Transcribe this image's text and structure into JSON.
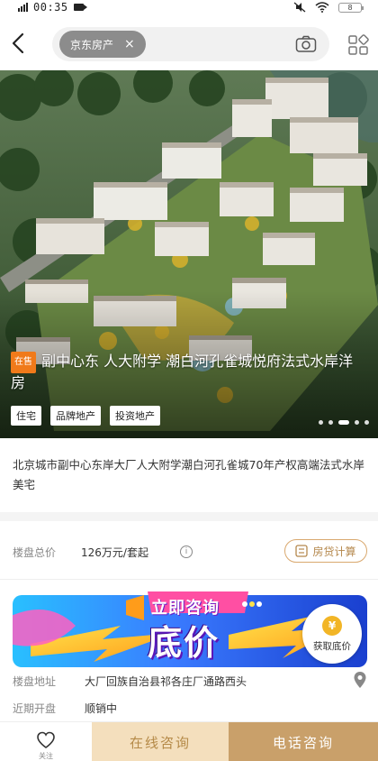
{
  "status_bar": {
    "time": "00:35",
    "battery": "8"
  },
  "header": {
    "search_chip": "京东房产",
    "chip_close": "×"
  },
  "hero": {
    "sale_badge": "在售",
    "title": "副中心东 人大附学 潮白河孔雀城悦府法式水岸洋房",
    "tags": [
      "住宅",
      "品牌地产",
      "投资地产"
    ],
    "slide_count": 6,
    "active_slide": 3
  },
  "description": "北京城市副中心东岸大厂人大附学潮白河孔雀城70年产权高端法式水岸美宅",
  "price": {
    "label": "楼盘总价",
    "value": "126万元/套起",
    "info_icon": "i",
    "mortgage_button": "房贷计算"
  },
  "banner": {
    "top_text": "立即咨询",
    "big_text": "底价",
    "button_label": "获取底价",
    "coin": "¥"
  },
  "address": {
    "label": "楼盘地址",
    "value": "大厂回族自治县祁各庄厂通路西头"
  },
  "opening": {
    "label": "近期开盘",
    "value": "顺销中"
  },
  "bottom_bar": {
    "favorite_label": "关注",
    "online_consult": "在线咨询",
    "phone_consult": "电话咨询"
  },
  "colors": {
    "accent_gold": "#c9a06a",
    "accent_light": "#f4dfbd",
    "badge_orange": "#f07a1a",
    "banner_purple": "#6a1ec7"
  }
}
